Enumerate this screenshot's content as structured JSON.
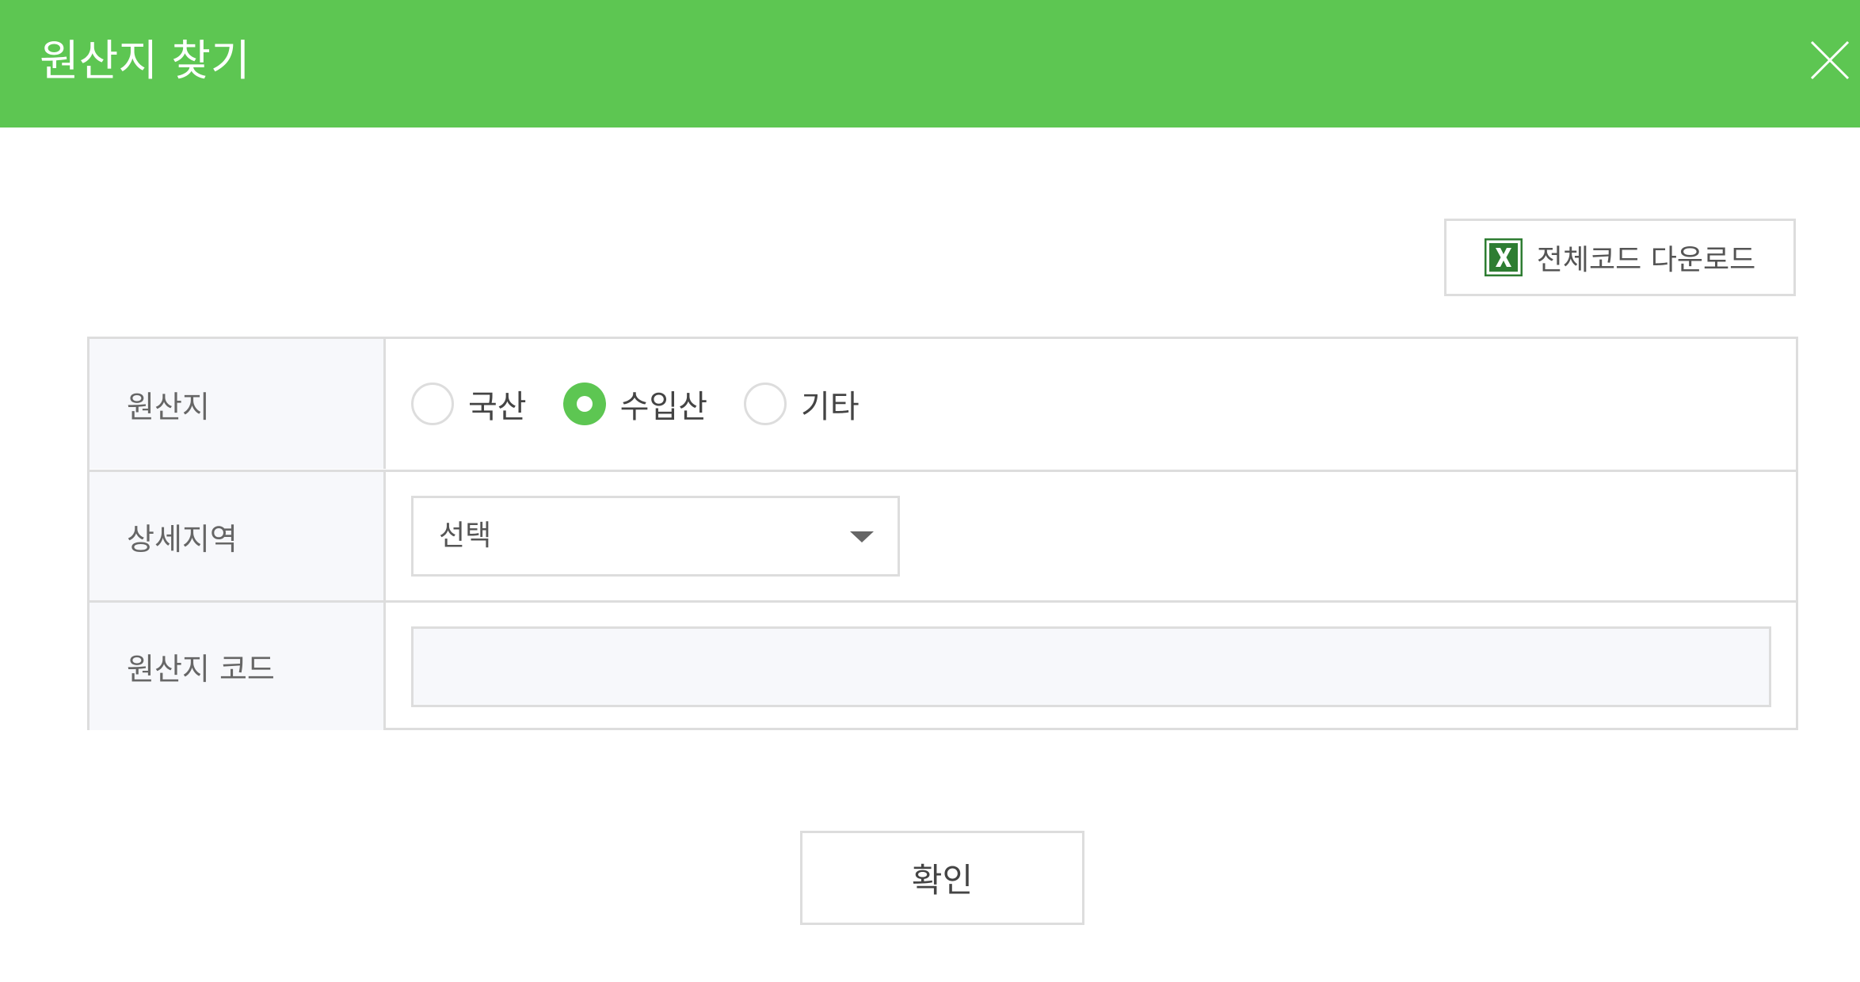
{
  "header": {
    "title": "원산지 찾기",
    "close_icon": "close-icon",
    "color": "#5dc652"
  },
  "toolbar": {
    "download_label": "전체코드 다운로드",
    "download_icon": "excel-icon"
  },
  "form": {
    "origin": {
      "label": "원산지",
      "options": [
        {
          "label": "국산",
          "checked": false
        },
        {
          "label": "수입산",
          "checked": true
        },
        {
          "label": "기타",
          "checked": false
        }
      ]
    },
    "region": {
      "label": "상세지역",
      "selected": "선택"
    },
    "code": {
      "label": "원산지 코드",
      "value": "",
      "placeholder": ""
    }
  },
  "footer": {
    "confirm_label": "확인"
  }
}
